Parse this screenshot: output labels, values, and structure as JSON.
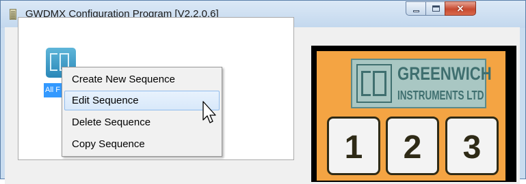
{
  "window": {
    "title": "GWDMX Configuration Program [V2.2.0.6]",
    "icon": "app-icon",
    "controls": {
      "minimize": "minimize-icon",
      "maximize": "maximize-icon",
      "close": "×"
    }
  },
  "sequence_panel": {
    "item_icon": "greenwich-sequence-icon",
    "item_label": "All F"
  },
  "context_menu": {
    "items": [
      {
        "label": "Create New Sequence"
      },
      {
        "label": "Edit Sequence",
        "highlighted": true
      },
      {
        "label": "Delete Sequence"
      },
      {
        "label": "Copy Sequence"
      }
    ]
  },
  "keypad": {
    "logo_line1": "GREENWICH",
    "logo_line2": "INSTRUMENTS LTD",
    "keys": [
      "1",
      "2",
      "3"
    ],
    "colors": {
      "body": "#f4a443",
      "logo": "#a9c7c3",
      "frame": "#000000"
    }
  },
  "colors": {
    "selection": "#3399ff",
    "menu_highlight": "#d8e8fa",
    "title_bar": "#c9dcef"
  }
}
